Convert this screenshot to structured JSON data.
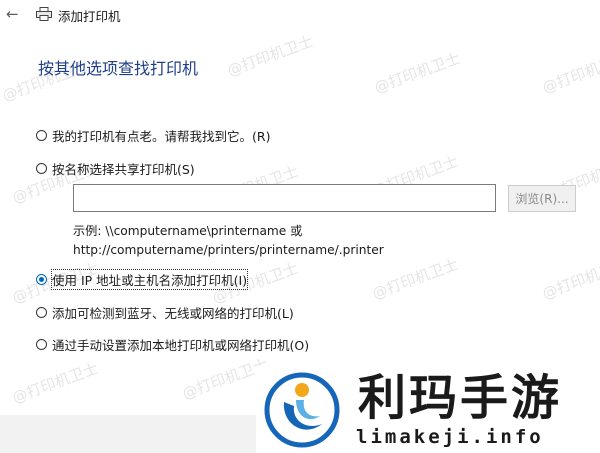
{
  "window": {
    "title": "添加打印机",
    "back_icon": "back-arrow-icon",
    "printer_icon": "printer-icon"
  },
  "heading": "按其他选项查找打印机",
  "options": [
    {
      "label": "我的打印机有点老。请帮我找到它。(R)",
      "checked": false
    },
    {
      "label": "按名称选择共享打印机(S)",
      "checked": false
    },
    {
      "label": "使用 IP 地址或主机名添加打印机(I)",
      "checked": true
    },
    {
      "label": "添加可检测到蓝牙、无线或网络的打印机(L)",
      "checked": false
    },
    {
      "label": "通过手动设置添加本地打印机或网络打印机(O)",
      "checked": false
    }
  ],
  "shared_printer": {
    "input_value": "",
    "browse_label": "浏览(R)...",
    "example_line1": "示例: \\\\computername\\printername 或",
    "example_line2": "http://computername/printers/printername/.printer"
  },
  "watermark_text": "@打印机卫士",
  "brand": {
    "name": "利玛手游",
    "domain": "limakeji.info"
  },
  "colors": {
    "heading": "#1f3f8a",
    "radio_selected": "#0067c0"
  }
}
